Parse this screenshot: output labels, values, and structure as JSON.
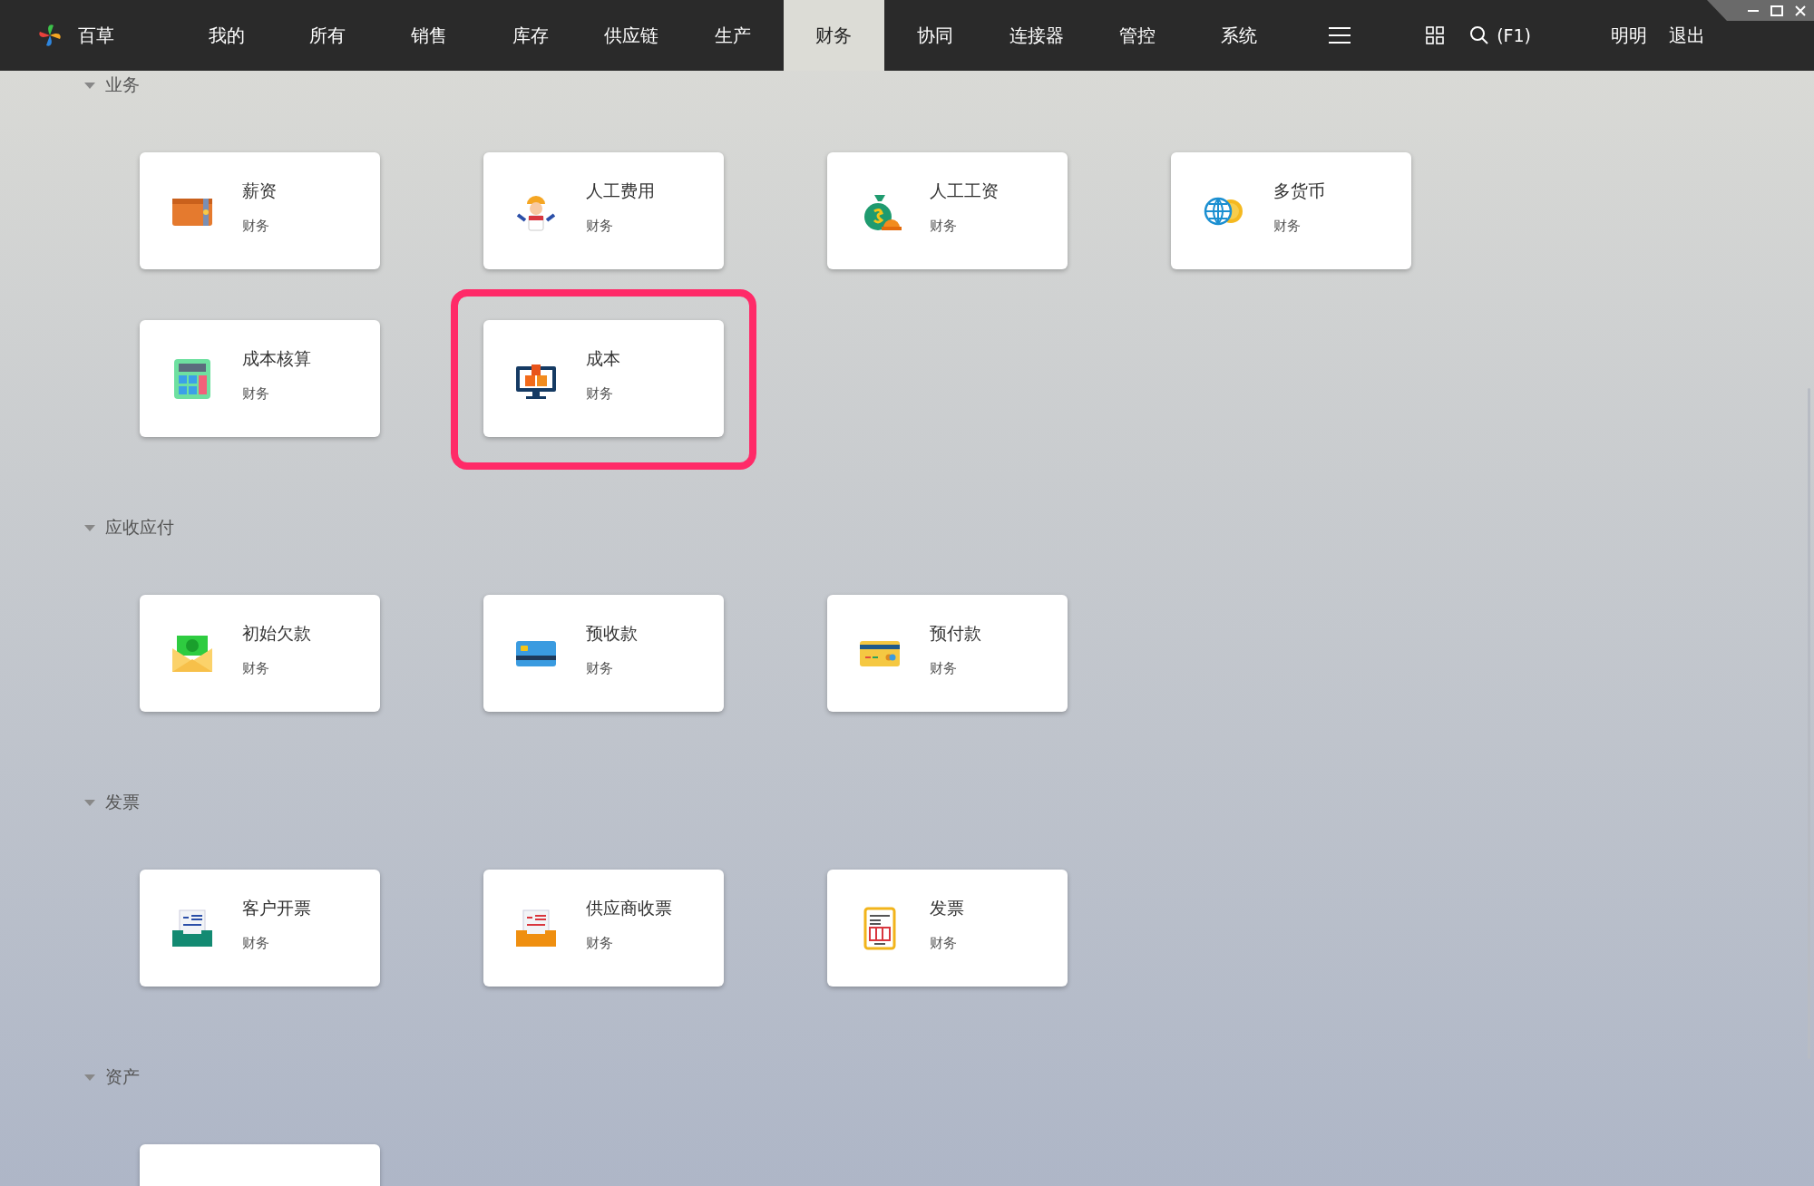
{
  "app": {
    "name": "百草"
  },
  "nav": {
    "tabs": [
      {
        "label": "我的",
        "selected": false
      },
      {
        "label": "所有",
        "selected": false
      },
      {
        "label": "销售",
        "selected": false
      },
      {
        "label": "库存",
        "selected": false
      },
      {
        "label": "供应链",
        "selected": false
      },
      {
        "label": "生产",
        "selected": false
      },
      {
        "label": "财务",
        "selected": true
      },
      {
        "label": "协同",
        "selected": false
      },
      {
        "label": "连接器",
        "selected": false
      },
      {
        "label": "管控",
        "selected": false
      },
      {
        "label": "系统",
        "selected": false
      }
    ],
    "search_hint": "(F1)",
    "user": "明明",
    "logout": "退出"
  },
  "sections": [
    {
      "title": "业务",
      "expanded": true,
      "cards": [
        {
          "title": "薪资",
          "subtitle": "财务",
          "highlighted": false
        },
        {
          "title": "人工费用",
          "subtitle": "财务",
          "highlighted": false
        },
        {
          "title": "人工工资",
          "subtitle": "财务",
          "highlighted": false
        },
        {
          "title": "多货币",
          "subtitle": "财务",
          "highlighted": false
        },
        {
          "title": "成本核算",
          "subtitle": "财务",
          "highlighted": false
        },
        {
          "title": "成本",
          "subtitle": "财务",
          "highlighted": true
        }
      ]
    },
    {
      "title": "应收应付",
      "expanded": true,
      "cards": [
        {
          "title": "初始欠款",
          "subtitle": "财务",
          "highlighted": false
        },
        {
          "title": "预收款",
          "subtitle": "财务",
          "highlighted": false
        },
        {
          "title": "预付款",
          "subtitle": "财务",
          "highlighted": false
        }
      ]
    },
    {
      "title": "发票",
      "expanded": true,
      "cards": [
        {
          "title": "客户开票",
          "subtitle": "财务",
          "highlighted": false
        },
        {
          "title": "供应商收票",
          "subtitle": "财务",
          "highlighted": false
        },
        {
          "title": "发票",
          "subtitle": "财务",
          "highlighted": false
        }
      ]
    },
    {
      "title": "资产",
      "expanded": true,
      "cards": [
        {
          "highlighted": false
        }
      ]
    }
  ]
}
